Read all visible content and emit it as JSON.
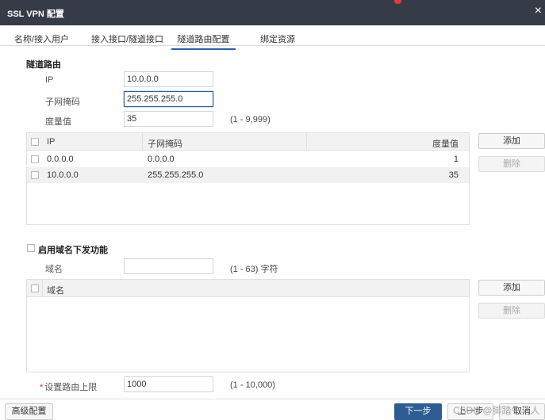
{
  "dialog": {
    "title": "SSL VPN 配置",
    "close_glyph": "×"
  },
  "tabs": [
    "名称/接入用户",
    "接入接口/隧道接口",
    "隧道路由配置",
    "绑定资源"
  ],
  "route": {
    "section_title": "隧道路由",
    "ip_label": "IP",
    "ip_value": "10.0.0.0",
    "mask_label": "子网掩码",
    "mask_value": "255.255.255.0",
    "metric_label": "度量值",
    "metric_value": "35",
    "metric_hint": "(1 - 9,999)",
    "table": {
      "headers": [
        "IP",
        "子网掩码",
        "度量值"
      ],
      "rows": [
        [
          "0.0.0.0",
          "0.0.0.0",
          "1"
        ],
        [
          "10.0.0.0",
          "255.255.255.0",
          "35"
        ]
      ]
    },
    "add_label": "添加",
    "delete_label": "删除"
  },
  "domain": {
    "enable_label": "启用域名下发功能",
    "domain_label": "域名",
    "domain_value": "",
    "domain_hint": "(1 - 63) 字符",
    "table": {
      "headers": [
        "域名"
      ]
    },
    "add_label": "添加",
    "delete_label": "删除"
  },
  "limit": {
    "required_mark": "*",
    "label": "设置路由上限",
    "value": "1000",
    "hint": "(1 - 10,000)"
  },
  "footer": {
    "advanced_label": "高级配置",
    "next_label": "下一步",
    "prev_label": "上一步",
    "cancel_label": "取消"
  },
  "watermark": "CSDN @脚踏牛马人",
  "colors": {
    "titlebar": "#353c48",
    "primary": "#2d5d93",
    "focus": "#2b5ca8"
  }
}
